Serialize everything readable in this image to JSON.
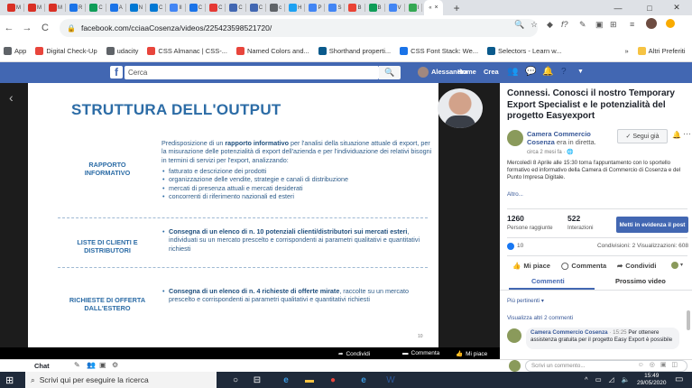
{
  "browser": {
    "tabs": [
      {
        "icon": "gmail-icon",
        "label": "M",
        "color": "#d93025"
      },
      {
        "icon": "gmail-icon",
        "label": "M",
        "color": "#d93025"
      },
      {
        "icon": "gmail-icon",
        "label": "M",
        "color": "#d93025"
      },
      {
        "icon": "drive-icon",
        "label": "R",
        "color": "#1a73e8"
      },
      {
        "icon": "sheets-icon",
        "label": "C",
        "color": "#0f9d58"
      },
      {
        "icon": "drive-icon",
        "label": "A",
        "color": "#1a73e8"
      },
      {
        "icon": "outlook-icon",
        "label": "N",
        "color": "#0078d4"
      },
      {
        "icon": "outlook-icon",
        "label": "C",
        "color": "#0078d4"
      },
      {
        "icon": "doc-icon",
        "label": "II",
        "color": "#4285f4"
      },
      {
        "icon": "plus-icon",
        "label": "C",
        "color": "#1a73e8"
      },
      {
        "icon": "circle-icon",
        "label": "C",
        "color": "#e53935"
      },
      {
        "icon": "facebook-icon",
        "label": "C",
        "color": "#4267b2"
      },
      {
        "icon": "facebook-icon",
        "label": "C",
        "color": "#4267b2"
      },
      {
        "icon": "doc-icon",
        "label": "c",
        "color": "#5f6368"
      },
      {
        "icon": "twitter-icon",
        "label": "H",
        "color": "#1da1f2"
      },
      {
        "icon": "chrome-icon",
        "label": "P",
        "color": "#4285f4"
      },
      {
        "icon": "chrome-icon",
        "label": "S",
        "color": "#4285f4"
      },
      {
        "icon": "circle-icon",
        "label": "B",
        "color": "#ea4335"
      },
      {
        "icon": "grid-icon",
        "label": "B",
        "color": "#0f9d58"
      },
      {
        "icon": "chrome-icon",
        "label": "V",
        "color": "#4285f4"
      },
      {
        "icon": "circle-icon",
        "label": "I",
        "color": "#34a853"
      }
    ],
    "active_tab": {
      "label": "«"
    },
    "active_tab_close": "×",
    "new_tab": "+",
    "window_controls": {
      "minimize": "—",
      "maximize": "□",
      "close": "✕"
    },
    "url": "facebook.com/cciaaCosenza/videos/225423598521720/",
    "bookmarks": [
      {
        "label": "App",
        "icon": "apps-icon",
        "color": "#5f6368"
      },
      {
        "label": "Digital Check-Up",
        "icon": "bookmark-icon",
        "color": "#e8453c"
      },
      {
        "label": "udacity",
        "icon": "page-icon",
        "color": "#5f6368"
      },
      {
        "label": "CSS Almanac | CSS-...",
        "icon": "css-icon",
        "color": "#e8453c"
      },
      {
        "label": "Named Colors and...",
        "icon": "css-icon",
        "color": "#e8453c"
      },
      {
        "label": "Shorthand properti...",
        "icon": "mdn-icon",
        "color": "#0a5a8c"
      },
      {
        "label": "CSS Font Stack: We...",
        "icon": "page-icon",
        "color": "#1a73e8"
      },
      {
        "label": "Selectors - Learn w...",
        "icon": "mdn-icon",
        "color": "#0a5a8c"
      }
    ],
    "bookmarks_more": "»",
    "other_bookmarks": "Altri Preferiti"
  },
  "facebook": {
    "logo": "f",
    "search_placeholder": "Cerca",
    "search_icon": "search-icon",
    "user": "Alessandra",
    "home": "Home",
    "create": "Crea",
    "brand_color": "#4267b2"
  },
  "slide": {
    "title": "STRUTTURA DELL'OUTPUT",
    "sections": [
      {
        "label": "RAPPORTO INFORMATIVO",
        "intro_before": "Predisposizione di un ",
        "intro_bold": "rapporto informativo",
        "intro_after": " per l'analisi della situazione attuale di export, per la misurazione delle potenzialità di export dell'azienda e per l'individuazione dei relativi bisogni in termini di servizi per l'export, analizzando:",
        "bullets": [
          "fatturato e descrizione dei prodotti",
          "organizzazione delle vendite, strategie e canali di distribuzione",
          "mercati di presenza attuali e mercati desiderati",
          "concorrenti di riferimento nazionali ed esteri"
        ]
      },
      {
        "label": "LISTE DI CLIENTI E DISTRIBUTORI",
        "bold": "Consegna di un elenco di n. 10 potenziali clienti/distributori sui mercati esteri",
        "rest": ", individuati su un mercato prescelto e corrispondenti ai parametri qualitativi e quantitativi richiesti"
      },
      {
        "label": "RICHIESTE DI OFFERTA DALL'ESTERO",
        "bold": "Consegna di un elenco di n. 4 richieste di offerte mirate",
        "rest": ", raccolte su un mercato prescelto e corrispondenti ai parametri qualitativi e quantitativi richiesti"
      }
    ],
    "page_number": "10"
  },
  "video_bar": {
    "share": "Condividi",
    "comment": "Commenta",
    "like": "Mi piace"
  },
  "post": {
    "title": "Connessi. Conosci il nostro Temporary Export Specialist e le potenzialità del progetto Easyexport",
    "page_name": "Camera Commercio Cosenza",
    "live_text": " era in diretta.",
    "time": "circa 2 mesi fa",
    "follow": "Segui già",
    "more": "···",
    "description": "Mercoledì 8 Aprile alle 15:30 torna l'appuntamento con lo sportello formativo ed informativo della Camera di Commercio di Cosenza e del Punto Impresa Digitale.",
    "read_more": "Altro...",
    "people_reached": "1260",
    "people_reached_label": "Persone raggiunte",
    "interactions": "522",
    "interactions_label": "Interazioni",
    "boost_button": "Metti in evidenza il post",
    "likes": "10",
    "shares_views": "Condivisioni: 2  Visualizzazioni: 608",
    "actions": {
      "like": "Mi piace",
      "comment": "Commenta",
      "share": "Condividi"
    },
    "tabs": {
      "comments": "Commenti",
      "next_video": "Prossimo video"
    },
    "sort": "Più pertinenti ▾",
    "show_more_comments": "Visualizza altri 2 commenti",
    "comment": {
      "author": "Camera Commercio Cosenza",
      "time": " · 15:25 ",
      "text": "Per ottenere assistenza gratuita per il progetto Easy Export è possibile"
    },
    "write_placeholder": "Scrivi un commento...",
    "write_icons": "☺ ◎ ▣ ◫"
  },
  "chat": {
    "label": "Chat"
  },
  "taskbar": {
    "search_placeholder": "Scrivi qui per eseguire la ricerca",
    "time": "15:49",
    "date": "29/05/2020",
    "tray": "^ ▭ ◿ 🔈"
  }
}
